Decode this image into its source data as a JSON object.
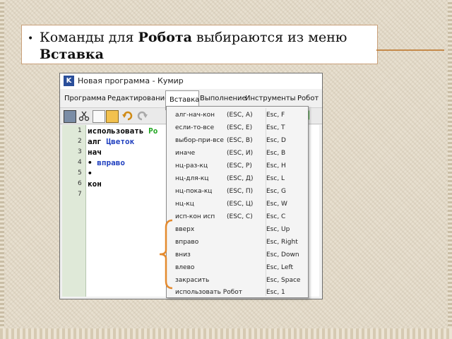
{
  "slide": {
    "bullet": "•",
    "line_prefix": "Команды для ",
    "bold1": "Робота",
    "line_middle": " выбираются из меню ",
    "bold2": "Вставка"
  },
  "window": {
    "title": "Новая программа - Кумир",
    "menu": [
      "Программа",
      "Редактирование",
      "Вставка",
      "Выполнение",
      "Инструменты",
      "Робот"
    ],
    "active_menu": "Вставка",
    "line_numbers": [
      "1",
      "2",
      "3",
      "4",
      "5",
      "6",
      "7"
    ],
    "code": {
      "l1_kw": "использовать",
      "l1_name": "Ро",
      "l2_kw": "алг",
      "l2_name": "Цветок",
      "l3": "нач",
      "l4_mark": "•",
      "l4_cmd": "вправо",
      "l5": "•",
      "l6": "кон"
    }
  },
  "dropdown": {
    "items": [
      {
        "label": "алг-нач-кон",
        "code": "(ESC, A)",
        "key": "Esc, F"
      },
      {
        "label": "если-то-все",
        "code": "(ESC, E)",
        "key": "Esc, T"
      },
      {
        "label": "выбор-при-все",
        "code": "(ESC, B)",
        "key": "Esc, D"
      },
      {
        "label": "иначе",
        "code": "(ESC, И)",
        "key": "Esc, B"
      },
      {
        "label": "нц-раз-кц",
        "code": "(ESC, P)",
        "key": "Esc, H"
      },
      {
        "label": "нц-для-кц",
        "code": "(ESC, Д)",
        "key": "Esc, L"
      },
      {
        "label": "нц-пока-кц",
        "code": "(ESC, П)",
        "key": "Esc, G"
      },
      {
        "label": "нц-кц",
        "code": "(ESC, Ц)",
        "key": "Esc, W"
      },
      {
        "label": "исп-кон исп",
        "code": "(ESC, С)",
        "key": "Esc, C"
      },
      {
        "label": "вверх",
        "code": "",
        "key": "Esc, Up"
      },
      {
        "label": "вправо",
        "code": "",
        "key": "Esc, Right"
      },
      {
        "label": "вниз",
        "code": "",
        "key": "Esc, Down"
      },
      {
        "label": "влево",
        "code": "",
        "key": "Esc, Left"
      },
      {
        "label": "закрасить",
        "code": "",
        "key": "Esc, Space"
      },
      {
        "label": "использовать Робот",
        "code": "",
        "key": "Esc, 1"
      }
    ]
  },
  "colors": {
    "bracket": "#e48a2e",
    "code_green": "#1aa31a",
    "code_blue": "#1f3fbf",
    "textbox_border": "#c9a07a"
  }
}
